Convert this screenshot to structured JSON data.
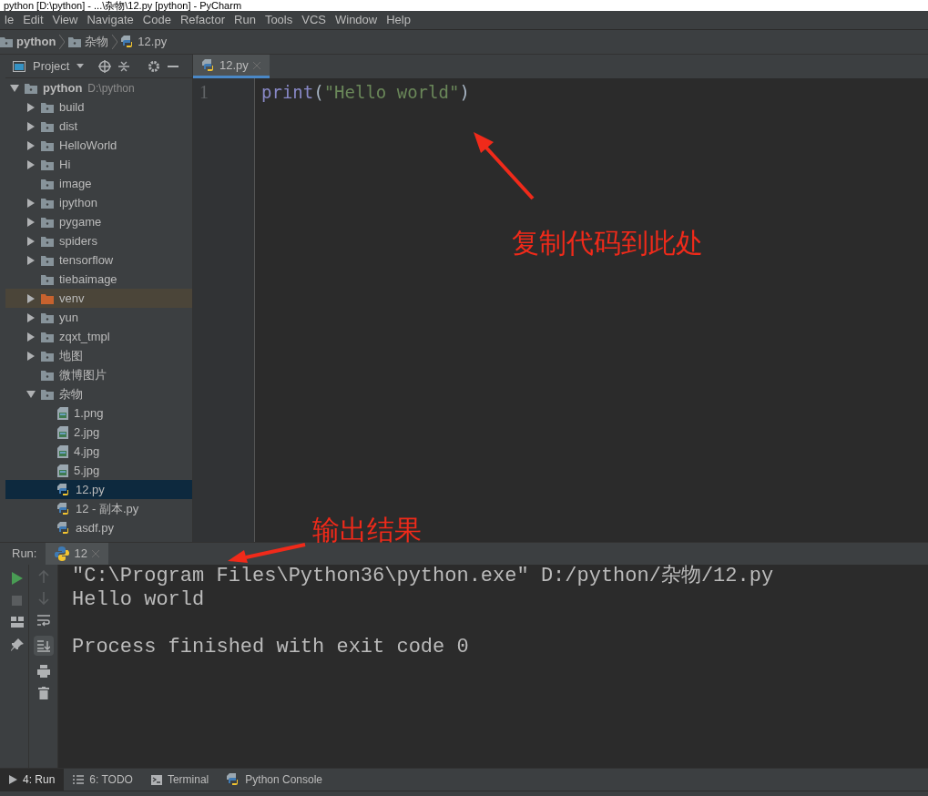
{
  "window": {
    "title": "python [D:\\python] - ...\\杂物\\12.py [python] - PyCharm"
  },
  "menu": [
    "le",
    "Edit",
    "View",
    "Navigate",
    "Code",
    "Refactor",
    "Run",
    "Tools",
    "VCS",
    "Window",
    "Help"
  ],
  "breadcrumb": [
    {
      "kind": "folder",
      "label": "python"
    },
    {
      "kind": "folder",
      "label": "杂物"
    },
    {
      "kind": "python",
      "label": "12.py"
    }
  ],
  "project_panel": {
    "title": "Project"
  },
  "tree": [
    {
      "kind": "folder",
      "label": "python",
      "path": "D:\\python",
      "expanded": true,
      "selected": false,
      "excluded": false,
      "children": [
        {
          "kind": "folder",
          "label": "build",
          "expanded": false,
          "selected": false,
          "excluded": false
        },
        {
          "kind": "folder",
          "label": "dist",
          "expanded": false,
          "selected": false,
          "excluded": false
        },
        {
          "kind": "folder",
          "label": "HelloWorld",
          "expanded": false,
          "selected": false,
          "excluded": false
        },
        {
          "kind": "folder",
          "label": "Hi",
          "expanded": false,
          "selected": false,
          "excluded": false
        },
        {
          "kind": "leaf-folder",
          "label": "image",
          "selected": false,
          "excluded": false
        },
        {
          "kind": "folder",
          "label": "ipython",
          "expanded": false,
          "selected": false,
          "excluded": false
        },
        {
          "kind": "folder",
          "label": "pygame",
          "expanded": false,
          "selected": false,
          "excluded": false
        },
        {
          "kind": "folder",
          "label": "spiders",
          "expanded": false,
          "selected": false,
          "excluded": false
        },
        {
          "kind": "folder",
          "label": "tensorflow",
          "expanded": false,
          "selected": false,
          "excluded": false
        },
        {
          "kind": "leaf-folder",
          "label": "tiebaimage",
          "selected": false,
          "excluded": false
        },
        {
          "kind": "folder",
          "label": "venv",
          "expanded": false,
          "selected": false,
          "excluded": true
        },
        {
          "kind": "folder",
          "label": "yun",
          "expanded": false,
          "selected": false,
          "excluded": false
        },
        {
          "kind": "folder",
          "label": "zqxt_tmpl",
          "expanded": false,
          "selected": false,
          "excluded": false
        },
        {
          "kind": "folder",
          "label": "地图",
          "expanded": false,
          "selected": false,
          "excluded": false
        },
        {
          "kind": "leaf-folder",
          "label": "微博图片",
          "selected": false,
          "excluded": false
        },
        {
          "kind": "folder",
          "label": "杂物",
          "expanded": true,
          "selected": false,
          "excluded": false,
          "children": [
            {
              "kind": "image",
              "label": "1.png",
              "selected": false,
              "excluded": false
            },
            {
              "kind": "image",
              "label": "2.jpg",
              "selected": false,
              "excluded": false
            },
            {
              "kind": "image",
              "label": "4.jpg",
              "selected": false,
              "excluded": false
            },
            {
              "kind": "image",
              "label": "5.jpg",
              "selected": false,
              "excluded": false
            },
            {
              "kind": "python",
              "label": "12.py",
              "selected": true,
              "excluded": false
            },
            {
              "kind": "python",
              "label": "12 - 副本.py",
              "selected": false,
              "excluded": false
            },
            {
              "kind": "python",
              "label": "asdf.py",
              "selected": false,
              "excluded": false
            }
          ]
        }
      ]
    }
  ],
  "editor": {
    "tabs": [
      {
        "label": "12.py",
        "selected": true
      }
    ],
    "lines": [
      {
        "number": "1",
        "tokens": [
          {
            "kind": "builtin",
            "text": "print"
          },
          {
            "kind": "punct",
            "text": "("
          },
          {
            "kind": "string",
            "text": "\"Hello world\""
          },
          {
            "kind": "punct",
            "text": ")"
          }
        ]
      }
    ]
  },
  "run_panel": {
    "label": "Run:",
    "tabs": [
      {
        "label": "12",
        "selected": true
      }
    ],
    "output_blocks": [
      [
        "\"C:\\Program Files\\Python36\\python.exe\" D:/python/杂物/12.py",
        "Hello world"
      ],
      [
        "Process finished with exit code 0"
      ]
    ]
  },
  "bottom_tabs": [
    {
      "kind": "run",
      "label": "4: Run",
      "selected": true
    },
    {
      "kind": "list",
      "label": "6: TODO",
      "selected": false
    },
    {
      "kind": "terminal",
      "label": "Terminal",
      "selected": false
    },
    {
      "kind": "python",
      "label": "Python Console",
      "selected": false
    }
  ],
  "annotations": [
    {
      "text": "复制代码到此处"
    },
    {
      "text": "输出结果"
    }
  ]
}
